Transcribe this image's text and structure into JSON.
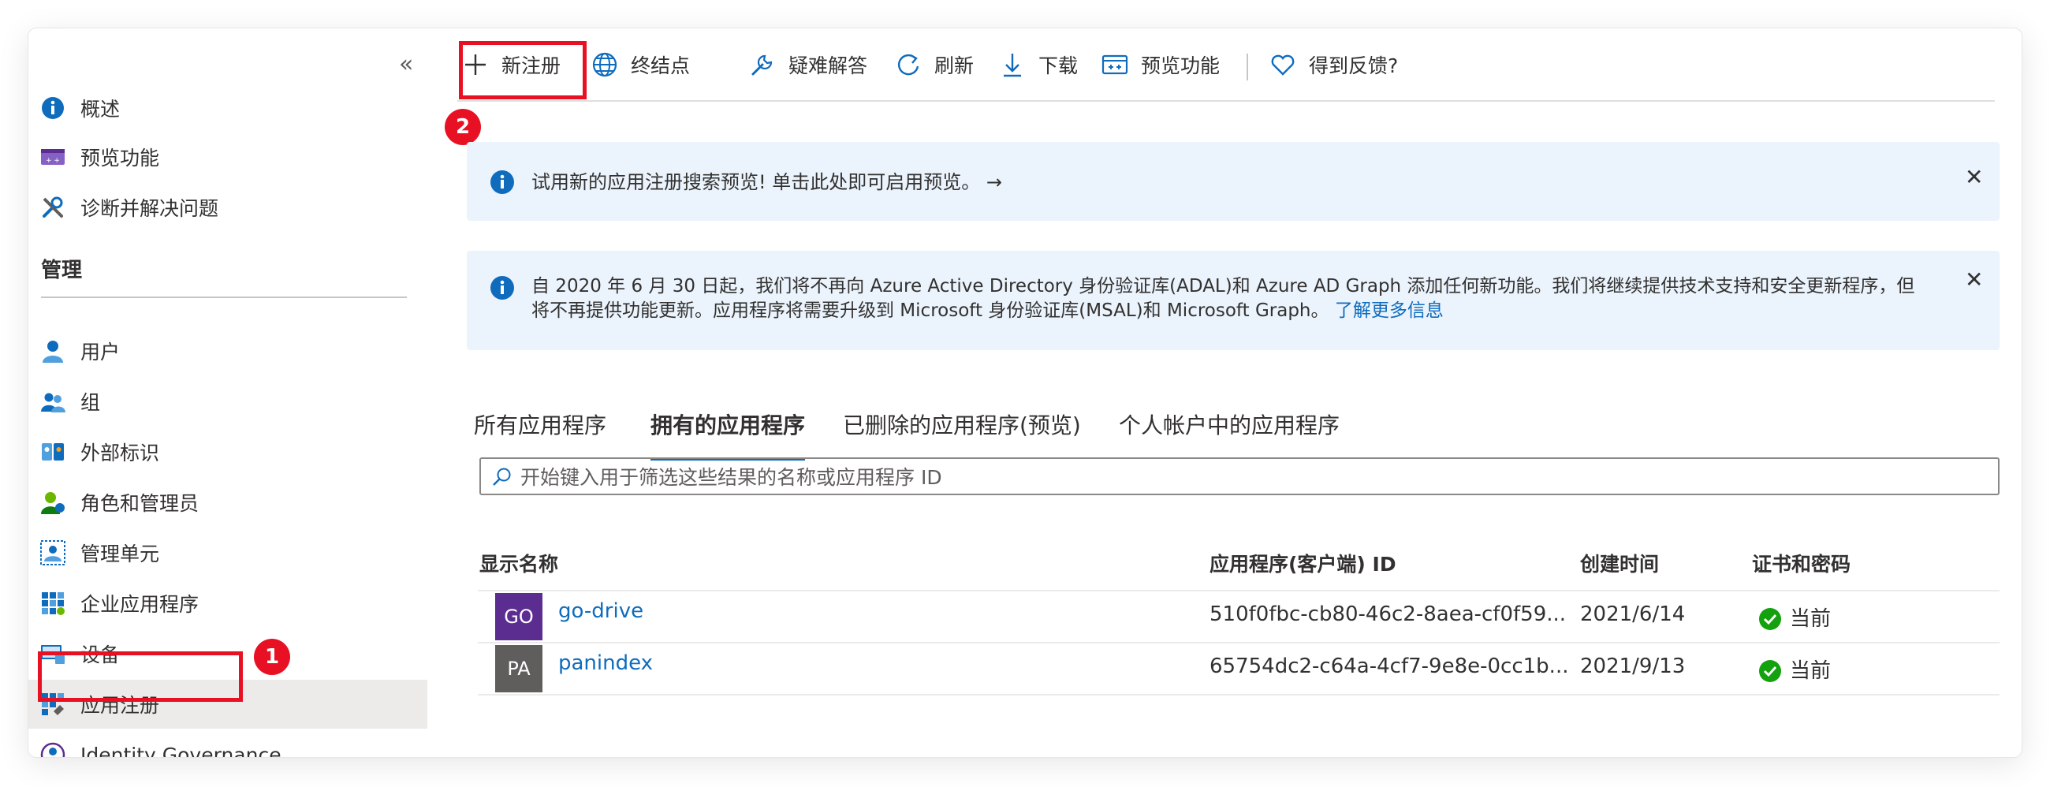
{
  "sidebar": {
    "collapse_glyph": "«",
    "items": [
      {
        "label": "概述",
        "icon": "info-icon"
      },
      {
        "label": "预览功能",
        "icon": "preview-features-icon"
      },
      {
        "label": "诊断并解决问题",
        "icon": "wrench-icon"
      }
    ],
    "section_title": "管理",
    "manage_items": [
      {
        "label": "用户",
        "icon": "user-icon"
      },
      {
        "label": "组",
        "icon": "group-icon"
      },
      {
        "label": "外部标识",
        "icon": "external-identities-icon"
      },
      {
        "label": "角色和管理员",
        "icon": "roles-icon"
      },
      {
        "label": "管理单元",
        "icon": "admin-units-icon"
      },
      {
        "label": "企业应用程序",
        "icon": "enterprise-apps-icon"
      },
      {
        "label": "设备",
        "icon": "devices-icon"
      },
      {
        "label": "应用注册",
        "icon": "app-registrations-icon",
        "active": true
      },
      {
        "label": "Identity Governance",
        "icon": "identity-governance-icon"
      }
    ]
  },
  "toolbar": {
    "new_registration": "新注册",
    "endpoints": "终结点",
    "troubleshoot": "疑难解答",
    "refresh": "刷新",
    "download": "下载",
    "preview_features": "预览功能",
    "feedback": "得到反馈?"
  },
  "annotations": {
    "badge_1": "1",
    "badge_2": "2",
    "highlight_color": "#e81123"
  },
  "banners": {
    "preview": {
      "text": "试用新的应用注册搜索预览! 单击此处即可启用预览。 →",
      "close": "✕"
    },
    "deprecation": {
      "line1": "自 2020 年 6 月 30 日起，我们将不再向 Azure Active Directory 身份验证库(ADAL)和 Azure AD Graph 添加任何新功能。我们将继续提供技术支持和安全更新程序，但",
      "line2": "将不再提供功能更新。应用程序将需要升级到 Microsoft 身份验证库(MSAL)和 Microsoft Graph。",
      "link": "了解更多信息",
      "close": "✕"
    }
  },
  "tabs": [
    {
      "label": "所有应用程序"
    },
    {
      "label": "拥有的应用程序",
      "active": true
    },
    {
      "label": "已删除的应用程序(预览)"
    },
    {
      "label": "个人帐户中的应用程序"
    }
  ],
  "search": {
    "placeholder": "开始键入用于筛选这些结果的名称或应用程序 ID",
    "value": ""
  },
  "table": {
    "headers": [
      "显示名称",
      "应用程序(客户端) ID",
      "创建时间",
      "证书和密码"
    ],
    "rows": [
      {
        "initials": "GO",
        "avatar_color": "#5c2d91",
        "name": "go-drive",
        "client_id": "510f0fbc-cb80-46c2-8aea-cf0f59...",
        "created": "2021/6/14",
        "status": "当前"
      },
      {
        "initials": "PA",
        "avatar_color": "#605e5c",
        "name": "panindex",
        "client_id": "65754dc2-c64a-4cf7-9e8e-0cc1b...",
        "created": "2021/9/13",
        "status": "当前"
      }
    ]
  },
  "colors": {
    "accent": "#0f6cbd",
    "status_ok": "#13a10e",
    "banner_bg": "#ebf3fc"
  }
}
